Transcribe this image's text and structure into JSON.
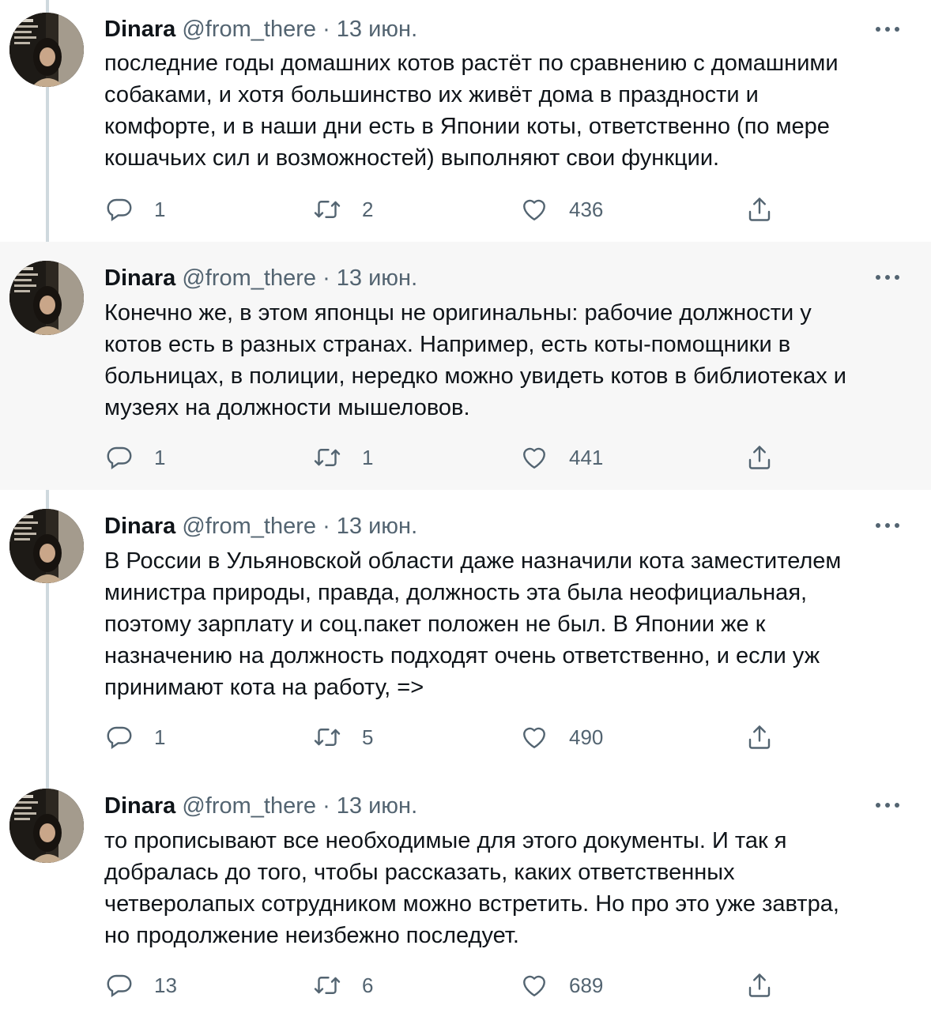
{
  "tweets": [
    {
      "author": "Dinara",
      "handle": "@from_there",
      "separator": "·",
      "date": "13 июн.",
      "lines": [
        "последние годы домашних котов растёт по сравнению с домашними",
        "собаками, и хотя большинство их живёт дома в праздности и",
        "комфорте, и в наши дни есть в Японии коты, ответственно (по мере",
        "кошачьих сил и возможностей) выполняют свои функции."
      ],
      "replies": "1",
      "retweets": "2",
      "likes": "436",
      "highlighted": false
    },
    {
      "author": "Dinara",
      "handle": "@from_there",
      "separator": "·",
      "date": "13 июн.",
      "lines": [
        "Конечно же, в этом японцы не оригинальны: рабочие должности у",
        "котов есть в разных странах. Например, есть коты-помощники в",
        "больницах, в полиции, нередко можно увидеть котов в библиотеках и",
        "музеях на должности мышеловов."
      ],
      "replies": "1",
      "retweets": "1",
      "likes": "441",
      "highlighted": true
    },
    {
      "author": "Dinara",
      "handle": "@from_there",
      "separator": "·",
      "date": "13 июн.",
      "lines": [
        "В России в Ульяновской области даже назначили кота заместителем",
        "министра природы, правда, должность эта была неофициальная,",
        "поэтому зарплату и соц.пакет положен не был. В Японии же к",
        "назначению на должность подходят очень ответственно, и если уж",
        "принимают кота на работу, =>"
      ],
      "replies": "1",
      "retweets": "5",
      "likes": "490",
      "highlighted": false
    },
    {
      "author": "Dinara",
      "handle": "@from_there",
      "separator": "·",
      "date": "13 июн.",
      "lines": [
        "то прописывают все необходимые для этого документы. И так я",
        "добралась до того, чтобы рассказать, каких ответственных",
        "четверолапых сотрудником можно встретить. Но про это уже завтра,",
        "но продолжение неизбежно последует."
      ],
      "replies": "13",
      "retweets": "6",
      "likes": "689",
      "highlighted": false
    }
  ],
  "icons": {
    "reply": "reply-icon",
    "retweet": "retweet-icon",
    "like": "heart-icon",
    "share": "share-icon",
    "more": "more-icon",
    "avatar": "profile-avatar"
  },
  "colors": {
    "text": "#0f1419",
    "muted": "#536471",
    "thread_line": "#cfd9de",
    "highlight_bg": "#f7f7f7"
  }
}
